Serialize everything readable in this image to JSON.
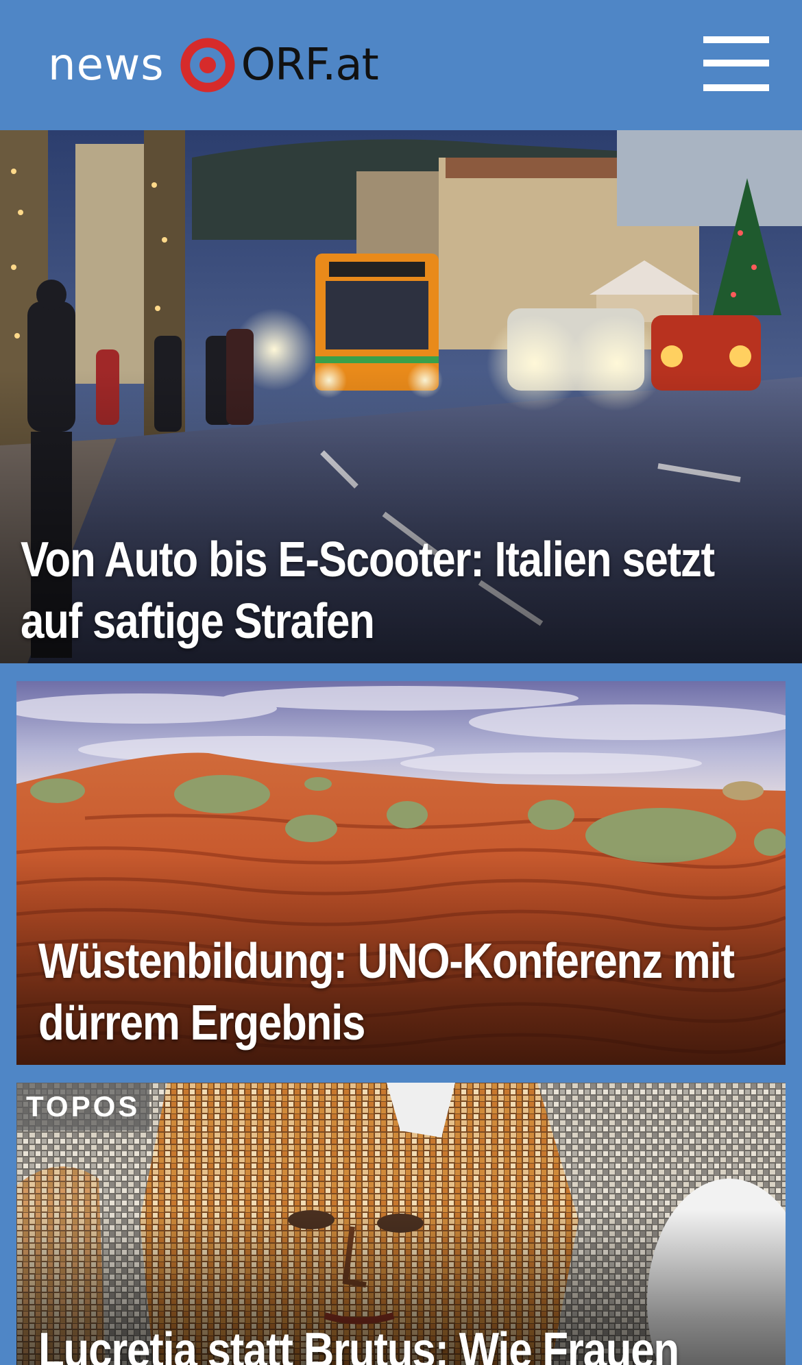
{
  "header": {
    "logo_news": "news",
    "logo_orf": "ORF.at",
    "logo_icon": "orf-target-icon",
    "menu_icon": "hamburger-menu-icon",
    "background_color": "#4f86c6",
    "logo_accent_color": "#d62b2b"
  },
  "stories": [
    {
      "title_line1": "Von Auto bis E-Scooter: Italien setzt",
      "title_line2": "auf saftige Strafen",
      "image": "city-street-bus-night-photo"
    },
    {
      "title_line1": "Wüstenbildung: UNO-Konferenz mit",
      "title_line2": "dürrem Ergebnis",
      "image": "red-desert-dunes-photo"
    },
    {
      "badge": "TOPOS",
      "title_line1": "Lucretia statt Brutus: Wie Frauen",
      "image": "mosaic-portrait-photo"
    }
  ]
}
